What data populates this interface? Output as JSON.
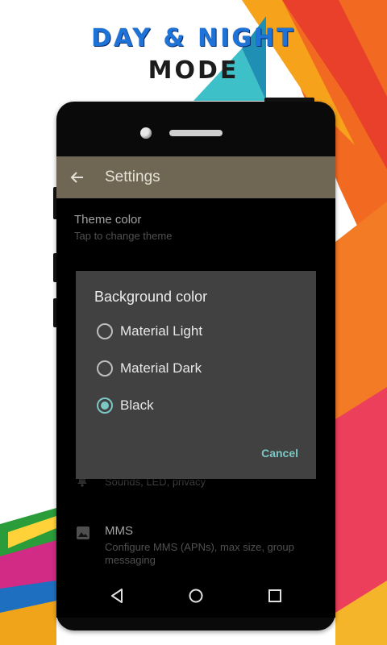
{
  "promo": {
    "line1": "DAY & NIGHT",
    "line2": "MODE"
  },
  "colors": {
    "accent": "#7cc6c4",
    "toolbar": "#6f6654",
    "dialog": "#414141",
    "promo_blue": "#1e73d8"
  },
  "toolbar": {
    "back_icon": "arrow-left-icon",
    "title": "Settings"
  },
  "settings": {
    "theme": {
      "title": "Theme color",
      "subtitle": "Tap to change theme"
    },
    "notifications": {
      "icon": "bell-icon",
      "subtitle": "Sounds, LED, privacy"
    },
    "mms": {
      "icon": "image-icon",
      "title": "MMS",
      "subtitle": "Configure MMS (APNs), max size, group messaging"
    }
  },
  "dialog": {
    "title": "Background color",
    "options": [
      {
        "label": "Material Light",
        "selected": false
      },
      {
        "label": "Material Dark",
        "selected": false
      },
      {
        "label": "Black",
        "selected": true
      }
    ],
    "cancel_label": "Cancel"
  },
  "navbar": {
    "back_icon": "triangle-back-icon",
    "home_icon": "circle-home-icon",
    "recents_icon": "square-recents-icon"
  }
}
